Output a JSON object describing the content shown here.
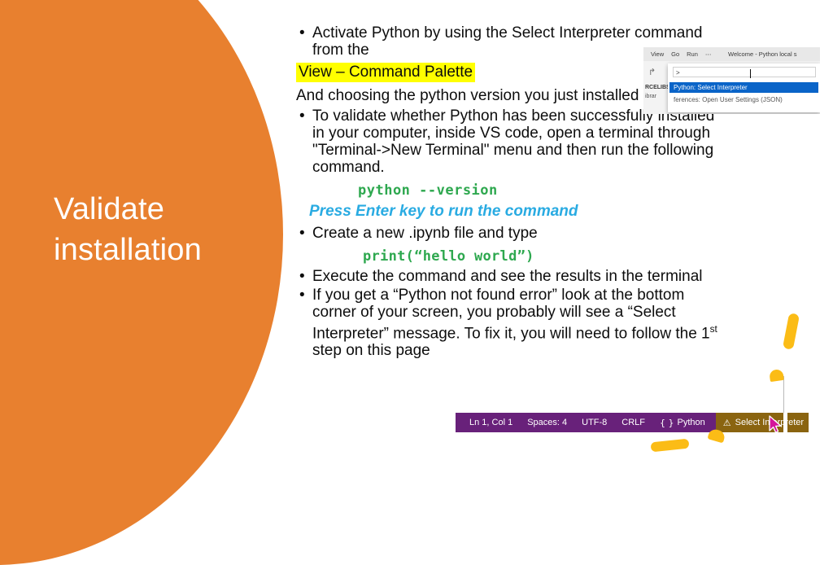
{
  "slide": {
    "title_line1": "Validate",
    "title_line2": "installation",
    "accent_orange": "#E8802F",
    "highlight_yellow": "#FFFF00",
    "code_green": "#2EA84F",
    "note_cyan": "#29ABE2",
    "ink_yellow": "#FBBC16",
    "statusbar_purple": "#68217A",
    "statusbar_warning_brown": "#8A6410",
    "palette_selection_blue": "#0A64C8"
  },
  "content": {
    "bullet1": "Activate Python by using the Select Interpreter command from the",
    "highlight1": "View – Command Palette",
    "plain1": "And choosing the python version you just installed",
    "bullet2": "To validate whether Python has been successfully installed in your computer, inside VS code, open a terminal through \"Terminal->New Terminal\" menu and then run the following command.",
    "code1": "python --version",
    "note1": "Press Enter key to run the command",
    "bullet3": "Create a new .ipynb file and type",
    "code2": "print(“hello world”)",
    "bullet4": "Execute the command and see the results in the terminal",
    "bullet5_part1": "If you get a “Python not found error” look at the bottom corner of your screen, you probably will see a “Select Interpreter” message. To fix it, you will need to follow the 1",
    "bullet5_sup": "st",
    "bullet5_part2": " step on this page",
    "bullet_glyph": "•"
  },
  "vscode_palette": {
    "menu": [
      "View",
      "Go",
      "Run",
      "⋯"
    ],
    "window_title": "Welcome - Python local s",
    "explorer_label": "RCELIBS",
    "explorer_sub": "ibrar",
    "input_value": ">",
    "option_selected": "Python: Select Interpreter",
    "option_second": "ferences: Open User Settings (JSON)",
    "pointer_glyph": "↱"
  },
  "vscode_statusbar": {
    "items": [
      "Ln 1, Col 1",
      "Spaces: 4",
      "UTF-8",
      "CRLF"
    ],
    "language_icon": "{ }",
    "language": "Python",
    "warning_icon": "⚠",
    "warning_text": "Select Interpreter"
  }
}
